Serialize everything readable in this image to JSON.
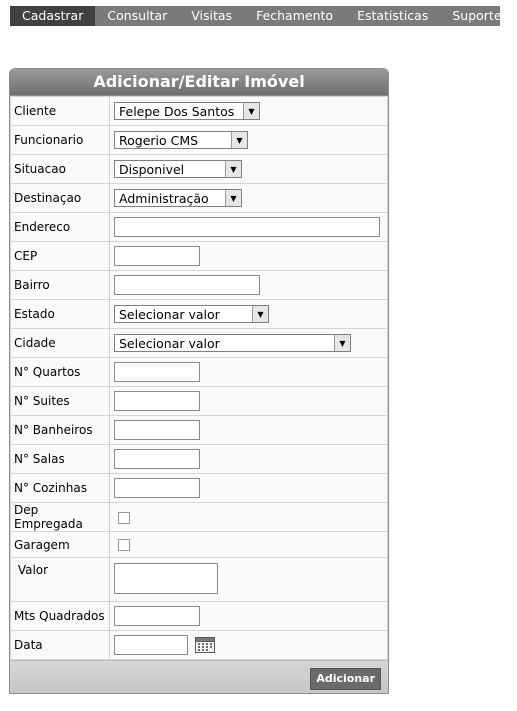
{
  "menu": {
    "items": [
      {
        "label": "Cadastrar",
        "active": true
      },
      {
        "label": "Consultar"
      },
      {
        "label": "Visitas"
      },
      {
        "label": "Fechamento"
      },
      {
        "label": "Estatisticas"
      },
      {
        "label": "Suporte"
      }
    ]
  },
  "form": {
    "title": "Adicionar/Editar Imóvel",
    "cliente": {
      "label": "Cliente",
      "value": "Felepe Dos Santos"
    },
    "funcionario": {
      "label": "Funcionario",
      "value": "Rogerio CMS"
    },
    "situacao": {
      "label": "Situacao",
      "value": "Disponivel"
    },
    "destinacao": {
      "label": "Destinaçao",
      "value": "Administração"
    },
    "endereco": {
      "label": "Endereco",
      "value": ""
    },
    "cep": {
      "label": "CEP",
      "value": ""
    },
    "bairro": {
      "label": "Bairro",
      "value": ""
    },
    "estado": {
      "label": "Estado",
      "value": "Selecionar valor"
    },
    "cidade": {
      "label": "Cidade",
      "value": "Selecionar valor"
    },
    "quartos": {
      "label": "N° Quartos",
      "value": ""
    },
    "suites": {
      "label": "N° Suites",
      "value": ""
    },
    "banheiros": {
      "label": "N° Banheiros",
      "value": ""
    },
    "salas": {
      "label": "N° Salas",
      "value": ""
    },
    "cozinhas": {
      "label": "N° Cozinhas",
      "value": ""
    },
    "dep_empregada": {
      "label": "Dep Empregada",
      "checked": false
    },
    "garagem": {
      "label": "Garagem",
      "checked": false
    },
    "valor": {
      "label": " Valor",
      "value": ""
    },
    "mts_quadrados": {
      "label": "Mts Quadrados",
      "value": ""
    },
    "data": {
      "label": "Data",
      "value": ""
    },
    "submit_label": "Adicionar"
  },
  "icons": {
    "dropdown": "chevron-down-icon",
    "calendar": "calendar-icon"
  },
  "colors": {
    "menu_bg": "#7a7a7a",
    "menu_active": "#404040",
    "header": "#7e7e7e",
    "button": "#6a6a6a"
  }
}
